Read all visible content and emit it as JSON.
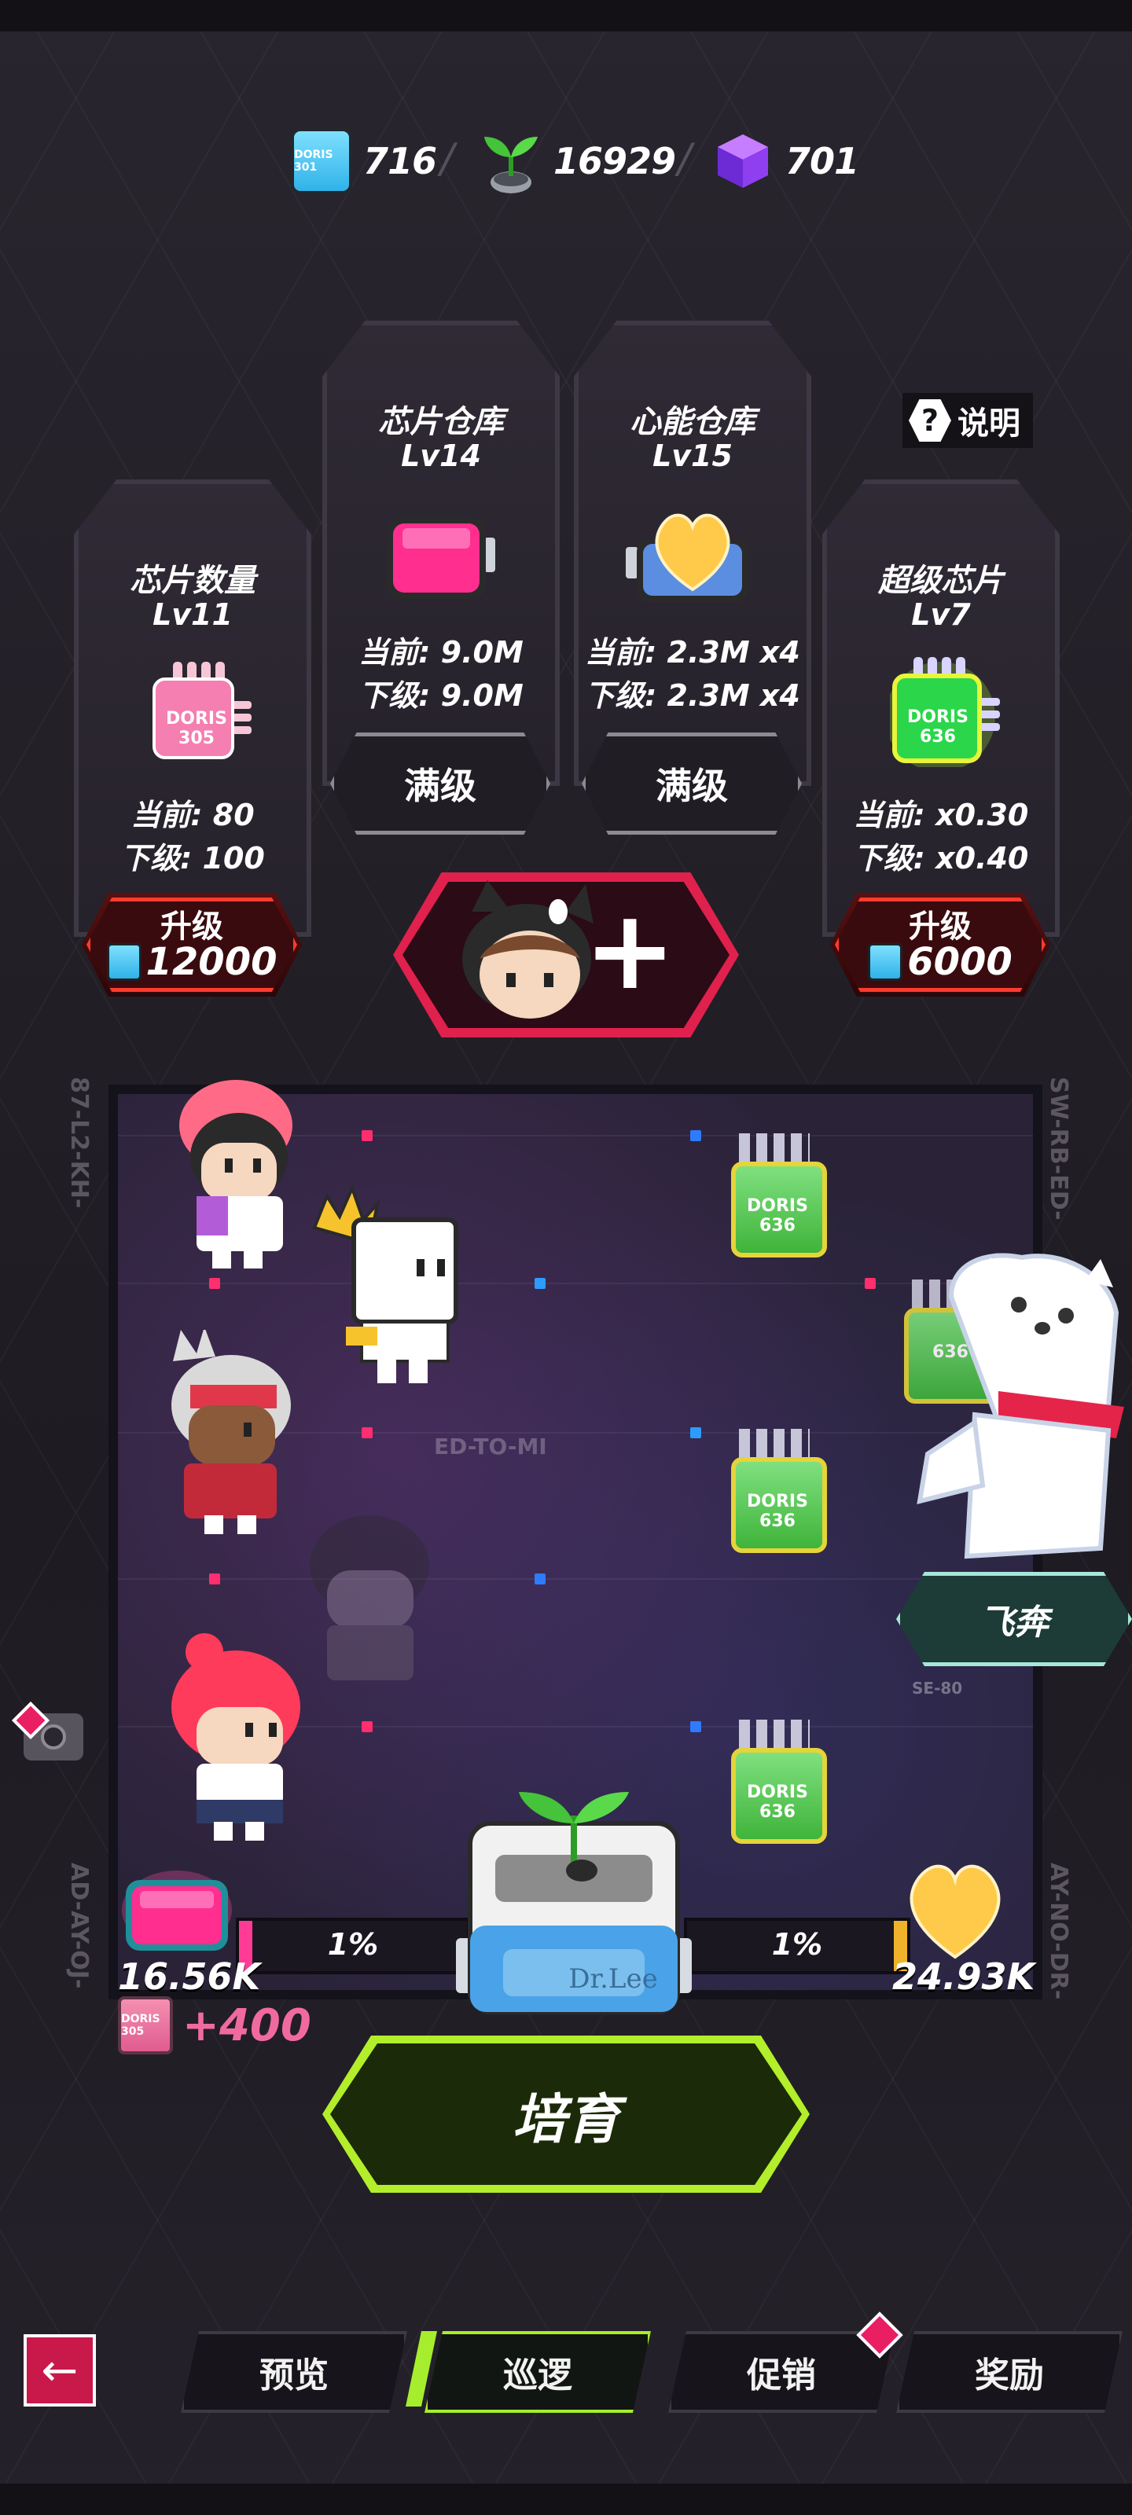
{
  "resources": [
    {
      "icon": "chip-icon",
      "chip_code": "DORIS 301",
      "value": "716"
    },
    {
      "icon": "sprout-icon",
      "value": "16929"
    },
    {
      "icon": "purple-cube-icon",
      "value": "701"
    }
  ],
  "separator": "/",
  "help": {
    "label": "说明"
  },
  "cards": [
    {
      "title": "芯片数量",
      "level": "Lv11",
      "icon": "pink-chip-icon",
      "chip_code": "DORIS 305",
      "current": "当前: 80",
      "next": "下级: 100",
      "button": {
        "label": "升级",
        "cost": "12000"
      }
    },
    {
      "title": "芯片仓库",
      "level": "Lv14",
      "icon": "pink-storage-icon",
      "current": "当前: 9.0M",
      "next": "下级: 9.0M",
      "button": {
        "label": "满级"
      }
    },
    {
      "title": "心能仓库",
      "level": "Lv15",
      "icon": "heart-storage-icon",
      "current": "当前: 2.3M x4",
      "next": "下级: 2.3M x4",
      "button": {
        "label": "满级"
      }
    },
    {
      "title": "超级芯片",
      "level": "Lv7",
      "icon": "green-chip-icon",
      "chip_code": "DORIS 636",
      "current": "当前: x0.30",
      "next": "下级: x0.40",
      "button": {
        "label": "升级",
        "cost": "6000"
      }
    }
  ],
  "add_hero": {
    "icon": "plus-icon",
    "symbol": "+"
  },
  "field": {
    "side_codes": [
      "87-L2-KH-",
      "SW-RB-ED-",
      "AD-AY-OJ-",
      "AY-NO-DR-"
    ],
    "center_text": "ED-TO-MI",
    "enemy_code": "DORIS 636",
    "partial_enemy_code": "636",
    "partial_code_right": "SE-80"
  },
  "dash_button": {
    "label": "飞奔"
  },
  "left_bar": {
    "percent": "1%",
    "fill": 0.01,
    "store_value": "16.56K"
  },
  "right_bar": {
    "percent": "1%",
    "fill": 0.01,
    "store_value": "24.93K"
  },
  "machine": {
    "label": "Dr.Lee"
  },
  "gain": {
    "chip_code": "DORIS 305",
    "value": "+400"
  },
  "breed_button": {
    "label": "培育"
  },
  "tabs": [
    {
      "label": "预览",
      "active": false
    },
    {
      "label": "巡逻",
      "active": true
    },
    {
      "label": "促销",
      "active": false,
      "badge": true
    },
    {
      "label": "奖励",
      "active": false
    }
  ],
  "colors": {
    "accent_green": "#a6ee2d",
    "accent_red": "#ff3b2e",
    "accent_pink": "#e91e63",
    "background": "#231f27"
  }
}
